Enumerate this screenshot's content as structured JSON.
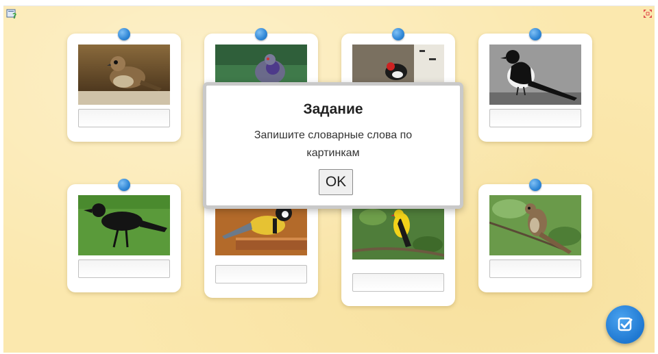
{
  "modal": {
    "title": "Задание",
    "text": "Запишите словарные слова по картинкам",
    "ok_label": "OK"
  },
  "toolbar": {
    "help_icon": "help-icon",
    "fullscreen_icon": "fullscreen-icon"
  },
  "cards": [
    {
      "id": 1,
      "subject": "sparrow",
      "answer": ""
    },
    {
      "id": 2,
      "subject": "pigeon",
      "answer": ""
    },
    {
      "id": 3,
      "subject": "woodpecker",
      "answer": ""
    },
    {
      "id": 4,
      "subject": "magpie",
      "answer": ""
    },
    {
      "id": 5,
      "subject": "crow",
      "answer": ""
    },
    {
      "id": 6,
      "subject": "tit",
      "answer": ""
    },
    {
      "id": 7,
      "subject": "oriole",
      "answer": ""
    },
    {
      "id": 8,
      "subject": "nightingale",
      "answer": ""
    }
  ],
  "colors": {
    "background": "#fbe8ae",
    "accent": "#1f78d1",
    "pin": "#2f86d6"
  },
  "check_icon": "check-icon"
}
